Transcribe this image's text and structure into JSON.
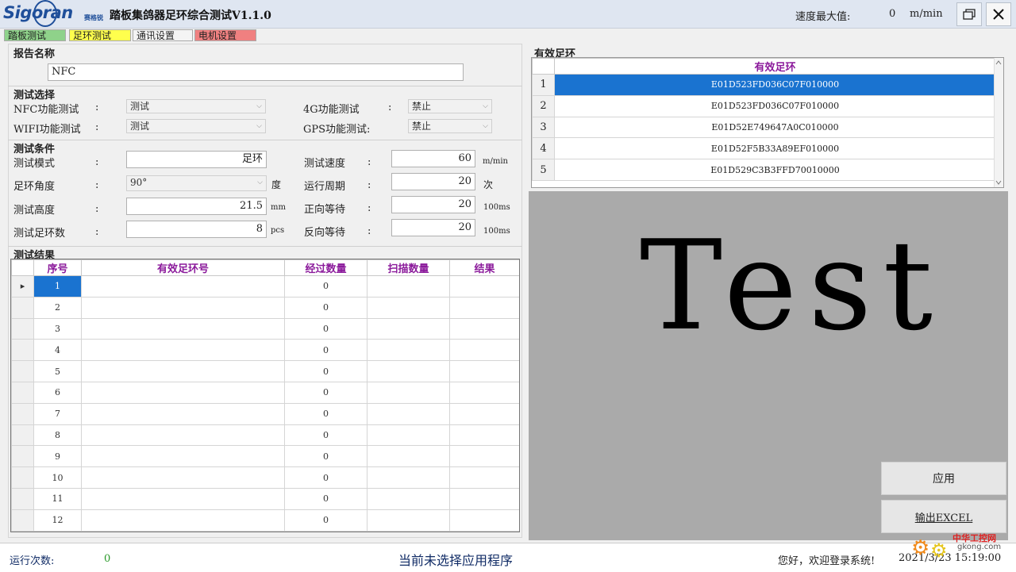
{
  "titlebar": {
    "logo_text": "Sigoran",
    "logo_sub": "赛格锐",
    "title": "踏板集鸽器足环综合测试V1.1.0",
    "speed_max_label": "速度最大值:",
    "speed_max_value": "0",
    "speed_unit": "m/min",
    "restore_icon": "restore-window-icon",
    "close_icon": "close-icon"
  },
  "tabs": [
    "踏板测试",
    "足环测试",
    "通讯设置",
    "电机设置"
  ],
  "report": {
    "section": "报告名称",
    "value": "NFC"
  },
  "test_select": {
    "section": "测试选择",
    "nfc_label": "NFC功能测试",
    "nfc_value": "测试",
    "wifi_label": "WIFI功能测试",
    "wifi_value": "测试",
    "g4_label": "4G功能测试",
    "g4_value": "禁止",
    "gps_label": "GPS功能测试:",
    "gps_value": "禁止"
  },
  "conditions": {
    "section": "测试条件",
    "mode_label": "测试模式",
    "mode_value": "足环",
    "angle_label": "足环角度",
    "angle_value": "90°",
    "angle_unit": "度",
    "height_label": "测试高度",
    "height_value": "21.5",
    "height_unit": "mm",
    "count_label": "测试足环数",
    "count_value": "8",
    "count_unit": "pcs",
    "speed_label": "测试速度",
    "speed_value": "60",
    "speed_unit": "m/min",
    "cycle_label": "运行周期",
    "cycle_value": "20",
    "cycle_unit": "次",
    "fwd_label": "正向等待",
    "fwd_value": "20",
    "fwd_unit": "100ms",
    "rev_label": "反向等待",
    "rev_value": "20",
    "rev_unit": "100ms",
    "colon": ":"
  },
  "results": {
    "section": "测试结果",
    "columns": [
      "序号",
      "有效足环号",
      "经过数量",
      "扫描数量",
      "结果"
    ],
    "rows": [
      {
        "seq": "1",
        "ring": "",
        "passed": "0",
        "scanned": "",
        "result": ""
      },
      {
        "seq": "2",
        "ring": "",
        "passed": "0",
        "scanned": "",
        "result": ""
      },
      {
        "seq": "3",
        "ring": "",
        "passed": "0",
        "scanned": "",
        "result": ""
      },
      {
        "seq": "4",
        "ring": "",
        "passed": "0",
        "scanned": "",
        "result": ""
      },
      {
        "seq": "5",
        "ring": "",
        "passed": "0",
        "scanned": "",
        "result": ""
      },
      {
        "seq": "6",
        "ring": "",
        "passed": "0",
        "scanned": "",
        "result": ""
      },
      {
        "seq": "7",
        "ring": "",
        "passed": "0",
        "scanned": "",
        "result": ""
      },
      {
        "seq": "8",
        "ring": "",
        "passed": "0",
        "scanned": "",
        "result": ""
      },
      {
        "seq": "9",
        "ring": "",
        "passed": "0",
        "scanned": "",
        "result": ""
      },
      {
        "seq": "10",
        "ring": "",
        "passed": "0",
        "scanned": "",
        "result": ""
      },
      {
        "seq": "11",
        "ring": "",
        "passed": "0",
        "scanned": "",
        "result": ""
      },
      {
        "seq": "12",
        "ring": "",
        "passed": "0",
        "scanned": "",
        "result": ""
      }
    ]
  },
  "valid_rings": {
    "section": "有效足环",
    "column": "有效足环",
    "rows": [
      {
        "idx": "1",
        "value": "E01D523FD036C07F010000"
      },
      {
        "idx": "2",
        "value": "E01D523FD036C07F010000"
      },
      {
        "idx": "3",
        "value": "E01D52E749647A0C010000"
      },
      {
        "idx": "4",
        "value": "E01D52F5B33A89EF010000"
      },
      {
        "idx": "5",
        "value": "E01D529C3B3FFD70010000"
      }
    ]
  },
  "display_text": "Test",
  "buttons": {
    "apply": "应用",
    "export": "输出EXCEL"
  },
  "status": {
    "run_label": "运行次数:",
    "run_value": "0",
    "message": "当前未选择应用程序",
    "welcome": "您好，欢迎登录系统!",
    "datetime": "2021/3/23 15:19:00"
  },
  "watermark": {
    "cn": "中华工控网",
    "en": "gkong.com"
  },
  "colors": {
    "selected": "#1a73d0",
    "header_text": "#8b1a9b",
    "tab_green": "#8fd28a",
    "tab_yellow": "#ffff4d",
    "tab_red": "#f08080"
  }
}
